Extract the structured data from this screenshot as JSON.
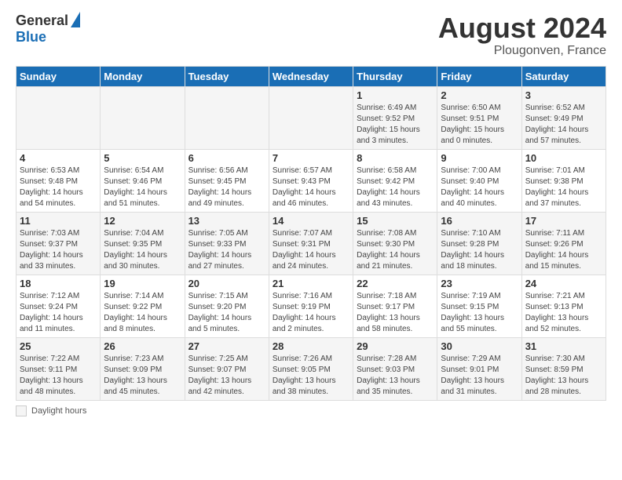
{
  "header": {
    "logo_general": "General",
    "logo_blue": "Blue",
    "month_year": "August 2024",
    "location": "Plougonven, France"
  },
  "footer": {
    "daylight_label": "Daylight hours"
  },
  "days_of_week": [
    "Sunday",
    "Monday",
    "Tuesday",
    "Wednesday",
    "Thursday",
    "Friday",
    "Saturday"
  ],
  "weeks": [
    [
      {
        "day": "",
        "detail": ""
      },
      {
        "day": "",
        "detail": ""
      },
      {
        "day": "",
        "detail": ""
      },
      {
        "day": "",
        "detail": ""
      },
      {
        "day": "1",
        "detail": "Sunrise: 6:49 AM\nSunset: 9:52 PM\nDaylight: 15 hours\nand 3 minutes."
      },
      {
        "day": "2",
        "detail": "Sunrise: 6:50 AM\nSunset: 9:51 PM\nDaylight: 15 hours\nand 0 minutes."
      },
      {
        "day": "3",
        "detail": "Sunrise: 6:52 AM\nSunset: 9:49 PM\nDaylight: 14 hours\nand 57 minutes."
      }
    ],
    [
      {
        "day": "4",
        "detail": "Sunrise: 6:53 AM\nSunset: 9:48 PM\nDaylight: 14 hours\nand 54 minutes."
      },
      {
        "day": "5",
        "detail": "Sunrise: 6:54 AM\nSunset: 9:46 PM\nDaylight: 14 hours\nand 51 minutes."
      },
      {
        "day": "6",
        "detail": "Sunrise: 6:56 AM\nSunset: 9:45 PM\nDaylight: 14 hours\nand 49 minutes."
      },
      {
        "day": "7",
        "detail": "Sunrise: 6:57 AM\nSunset: 9:43 PM\nDaylight: 14 hours\nand 46 minutes."
      },
      {
        "day": "8",
        "detail": "Sunrise: 6:58 AM\nSunset: 9:42 PM\nDaylight: 14 hours\nand 43 minutes."
      },
      {
        "day": "9",
        "detail": "Sunrise: 7:00 AM\nSunset: 9:40 PM\nDaylight: 14 hours\nand 40 minutes."
      },
      {
        "day": "10",
        "detail": "Sunrise: 7:01 AM\nSunset: 9:38 PM\nDaylight: 14 hours\nand 37 minutes."
      }
    ],
    [
      {
        "day": "11",
        "detail": "Sunrise: 7:03 AM\nSunset: 9:37 PM\nDaylight: 14 hours\nand 33 minutes."
      },
      {
        "day": "12",
        "detail": "Sunrise: 7:04 AM\nSunset: 9:35 PM\nDaylight: 14 hours\nand 30 minutes."
      },
      {
        "day": "13",
        "detail": "Sunrise: 7:05 AM\nSunset: 9:33 PM\nDaylight: 14 hours\nand 27 minutes."
      },
      {
        "day": "14",
        "detail": "Sunrise: 7:07 AM\nSunset: 9:31 PM\nDaylight: 14 hours\nand 24 minutes."
      },
      {
        "day": "15",
        "detail": "Sunrise: 7:08 AM\nSunset: 9:30 PM\nDaylight: 14 hours\nand 21 minutes."
      },
      {
        "day": "16",
        "detail": "Sunrise: 7:10 AM\nSunset: 9:28 PM\nDaylight: 14 hours\nand 18 minutes."
      },
      {
        "day": "17",
        "detail": "Sunrise: 7:11 AM\nSunset: 9:26 PM\nDaylight: 14 hours\nand 15 minutes."
      }
    ],
    [
      {
        "day": "18",
        "detail": "Sunrise: 7:12 AM\nSunset: 9:24 PM\nDaylight: 14 hours\nand 11 minutes."
      },
      {
        "day": "19",
        "detail": "Sunrise: 7:14 AM\nSunset: 9:22 PM\nDaylight: 14 hours\nand 8 minutes."
      },
      {
        "day": "20",
        "detail": "Sunrise: 7:15 AM\nSunset: 9:20 PM\nDaylight: 14 hours\nand 5 minutes."
      },
      {
        "day": "21",
        "detail": "Sunrise: 7:16 AM\nSunset: 9:19 PM\nDaylight: 14 hours\nand 2 minutes."
      },
      {
        "day": "22",
        "detail": "Sunrise: 7:18 AM\nSunset: 9:17 PM\nDaylight: 13 hours\nand 58 minutes."
      },
      {
        "day": "23",
        "detail": "Sunrise: 7:19 AM\nSunset: 9:15 PM\nDaylight: 13 hours\nand 55 minutes."
      },
      {
        "day": "24",
        "detail": "Sunrise: 7:21 AM\nSunset: 9:13 PM\nDaylight: 13 hours\nand 52 minutes."
      }
    ],
    [
      {
        "day": "25",
        "detail": "Sunrise: 7:22 AM\nSunset: 9:11 PM\nDaylight: 13 hours\nand 48 minutes."
      },
      {
        "day": "26",
        "detail": "Sunrise: 7:23 AM\nSunset: 9:09 PM\nDaylight: 13 hours\nand 45 minutes."
      },
      {
        "day": "27",
        "detail": "Sunrise: 7:25 AM\nSunset: 9:07 PM\nDaylight: 13 hours\nand 42 minutes."
      },
      {
        "day": "28",
        "detail": "Sunrise: 7:26 AM\nSunset: 9:05 PM\nDaylight: 13 hours\nand 38 minutes."
      },
      {
        "day": "29",
        "detail": "Sunrise: 7:28 AM\nSunset: 9:03 PM\nDaylight: 13 hours\nand 35 minutes."
      },
      {
        "day": "30",
        "detail": "Sunrise: 7:29 AM\nSunset: 9:01 PM\nDaylight: 13 hours\nand 31 minutes."
      },
      {
        "day": "31",
        "detail": "Sunrise: 7:30 AM\nSunset: 8:59 PM\nDaylight: 13 hours\nand 28 minutes."
      }
    ]
  ]
}
